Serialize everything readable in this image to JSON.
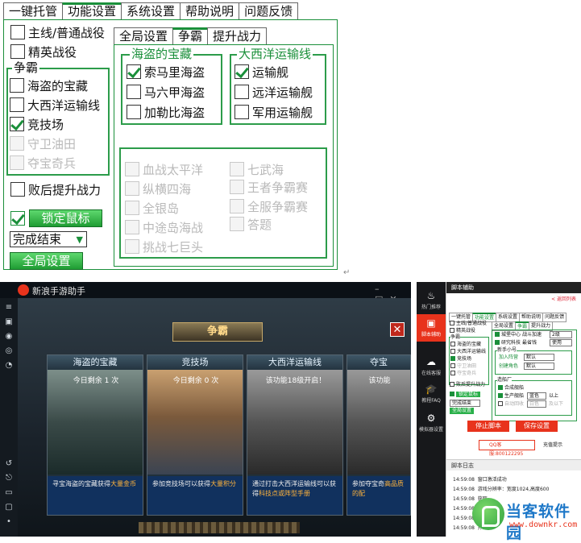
{
  "top": {
    "tabs": [
      "一键托管",
      "功能设置",
      "系统设置",
      "帮助说明",
      "问题反馈"
    ],
    "active_tab": 1,
    "left_checks": [
      {
        "label": "主线/普通战役",
        "checked": false
      },
      {
        "label": "精英战役",
        "checked": false
      }
    ],
    "zhengba_group": {
      "title": "争霸",
      "items": [
        {
          "label": "海盗的宝藏",
          "checked": false,
          "disabled": false
        },
        {
          "label": "大西洋运输线",
          "checked": false,
          "disabled": false
        },
        {
          "label": "竞技场",
          "checked": true,
          "disabled": false
        },
        {
          "label": "守卫油田",
          "checked": false,
          "disabled": true
        },
        {
          "label": "夺宝奇兵",
          "checked": false,
          "disabled": true
        }
      ]
    },
    "after_defeat": {
      "label": "败后提升战力",
      "checked": false
    },
    "lock_mouse": {
      "label": "锁定鼠标",
      "checked": true
    },
    "finish_select": {
      "value": "完成结束",
      "arrow": "▼"
    },
    "global_button": "全局设置",
    "subtabs": [
      "全局设置",
      "争霸",
      "提升战力"
    ],
    "active_subtab": 1,
    "pirate_group": {
      "title": "海盗的宝藏",
      "items": [
        {
          "label": "索马里海盗",
          "checked": true
        },
        {
          "label": "马六甲海盗",
          "checked": false
        },
        {
          "label": "加勒比海盗",
          "checked": false
        }
      ]
    },
    "atlantic_group": {
      "title": "大西洋运输线",
      "items": [
        {
          "label": "运输舰",
          "checked": true
        },
        {
          "label": "远洋运输舰",
          "checked": false
        },
        {
          "label": "军用运输舰",
          "checked": false
        }
      ]
    },
    "disabled_left": [
      "血战太平洋",
      "纵横四海",
      "全银岛",
      "中途岛海战",
      "挑战七巨头"
    ],
    "disabled_right": [
      "七武海",
      "王者争霸赛",
      "全服争霸赛",
      "答题"
    ],
    "corner_mark": "↵"
  },
  "game": {
    "title": "新浪手游助手",
    "banner": "争霸",
    "close": "✕",
    "left_icons": [
      "≡",
      "▣",
      "◉",
      "◎",
      "◔",
      "↺",
      "⎋",
      "▭",
      "▢",
      "•",
      "⌂"
    ],
    "cards": [
      {
        "title": "海盗的宝藏",
        "sub": "今日剩余 1 次",
        "desc_pre": "寻宝海盗的宝藏获得",
        "desc_hl": "大量金币",
        "desc_post": ""
      },
      {
        "title": "竞技场",
        "sub": "今日剩余 0 次",
        "desc_pre": "参加竞技场可以获得",
        "desc_hl": "大量积分",
        "desc_post": ""
      },
      {
        "title": "大西洋运输线",
        "sub": "该功能18级开启！",
        "desc_pre": "通过打击大西洋运输线可以获得",
        "desc_hl": "科技点或阵型手册",
        "desc_post": ""
      },
      {
        "title": "夺宝",
        "sub": "该功能",
        "desc_pre": "参加夺宝奇",
        "desc_hl": "高品质的配",
        "desc_post": ""
      }
    ]
  },
  "helper": {
    "header": "脚本辅助",
    "back": "< 返回列表",
    "side": [
      {
        "label": "热门推荐",
        "icon": "♨",
        "active": false
      },
      {
        "label": "脚本辅助",
        "icon": "▣",
        "active": true
      },
      {
        "label": "在线客服",
        "icon": "☁",
        "active": false
      },
      {
        "label": "教程FAQ",
        "icon": "🎓",
        "active": false
      },
      {
        "label": "模拟器设置",
        "icon": "⚙",
        "active": false
      }
    ],
    "tabs": [
      "一键托管",
      "功能设置",
      "系统设置",
      "帮助说明",
      "问题反馈"
    ],
    "subtabs": [
      "全局设置",
      "争霸",
      "提升战力"
    ],
    "left_items": [
      "主线/普通战役",
      "精英战役",
      "争霸",
      "海盗的宝藏",
      "大西洋运输线",
      "竞技场",
      "守卫油田",
      "夺宝奇兵",
      "败后提升战力"
    ],
    "lock": "锁定鼠标",
    "finish": "完成结束",
    "global": "全局设置",
    "r_rows": [
      {
        "label": "城堡中心",
        "val": "战斗加速",
        "sel": "2级"
      },
      {
        "label": "研究科技",
        "val": "最省钱",
        "sel": "使用"
      }
    ],
    "newbie_title": "新手小号",
    "newbie": [
      {
        "label": "加入阵营",
        "sel": "默认"
      },
      {
        "label": "创建角色",
        "sel": "默认"
      }
    ],
    "factory_title": "造船厂",
    "factory": [
      {
        "label": "合成舰船"
      },
      {
        "label": "生产舰船",
        "sel": "蓝色",
        "extra": "以上"
      },
      {
        "label": "自动回收",
        "sel": "白色",
        "extra": "及以下"
      }
    ],
    "stop_btn": "停止脚本",
    "save_btn": "保存设置",
    "qq": "QQ客服:800122295",
    "recharge": "充值提示",
    "log_title": "脚本日志",
    "logs": [
      {
        "time": "14:59:08",
        "msg": "窗口激活成功"
      },
      {
        "time": "14:59:08",
        "msg": "游戏分辨率：宽度1024,高度600"
      },
      {
        "time": "14:59:08",
        "msg": "获取"
      },
      {
        "time": "14:59:08",
        "msg": "开始"
      },
      {
        "time": "14:59:08",
        "msg": "开始"
      },
      {
        "time": "14:59:08",
        "msg": "开始"
      }
    ]
  },
  "watermark": {
    "name": "当客软件园",
    "url": "www.downkr.com"
  }
}
